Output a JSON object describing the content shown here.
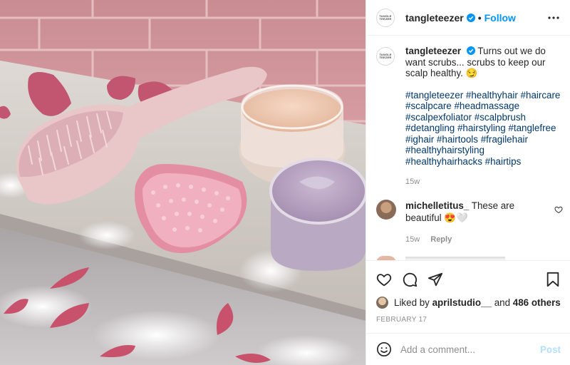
{
  "post": {
    "image_alt": "Pink detangling brush and scalp brush on a bath shelf with rose petals and jars of scrub",
    "account": {
      "username": "tangleteezer",
      "logo_text": "TANGLE TEEZER",
      "follow_label": "Follow",
      "verified": true
    },
    "caption": {
      "username": "tangleteezer",
      "text": "Turns out we do want scrubs... scrubs to keep our scalp healthy. 😏",
      "hashtags": "#tangleteezer #healthyhair #haircare #scalpcare #headmassage #scalpexfoliator #scalpbrush #detangling #hairstyling #tanglefree #ighair #hairtools #fragilehair #healthyhairstyling #healthyhairhacks #hairtips",
      "age": "15w"
    },
    "comments": [
      {
        "username": "michelletitus_",
        "text": "These are beautiful 😍🤍",
        "age": "15w",
        "reply_label": "Reply"
      }
    ],
    "likes": {
      "prefix": "Liked by",
      "user": "aprilstudio__",
      "joiner": "and",
      "others": "486 others"
    },
    "date": "FEBRUARY 17",
    "add_comment": {
      "placeholder": "Add a comment...",
      "post_label": "Post"
    }
  },
  "colors": {
    "accent": "#0095f6",
    "hashtag": "#00376b",
    "muted": "#8e8e8e",
    "post_disabled": "#b2dffc"
  },
  "icons": [
    "more-options-icon",
    "verified-badge-icon",
    "heart-icon",
    "comment-icon",
    "share-icon",
    "bookmark-icon",
    "emoji-icon"
  ]
}
